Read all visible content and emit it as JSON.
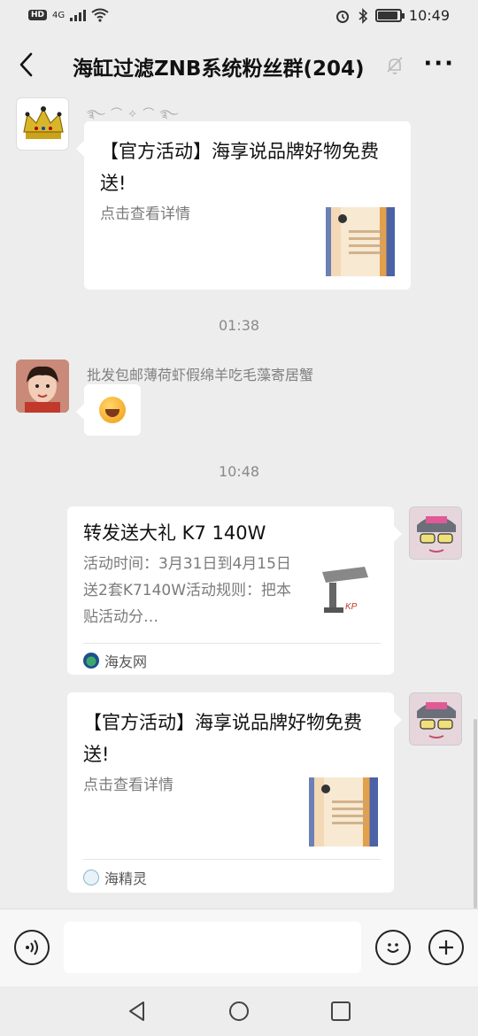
{
  "status_bar": {
    "hd": "HD",
    "network": "4G",
    "time": "10:49",
    "battery_level": 0.9
  },
  "nav": {
    "title": "海缸过滤ZNB系统粉丝群(204)",
    "more": "···"
  },
  "messages": {
    "first_card": {
      "title": "【官方活动】海享说品牌好物免费送!",
      "desc": "点击查看详情"
    },
    "time1": "01:38",
    "sender2": "批发包邮薄荷虾假绵羊吃毛藻寄居蟹",
    "time2": "10:48",
    "card2": {
      "title": "转发送大礼 K7 140W",
      "desc": "活动时间：3月31日到4月15日送2套K7140W活动规则：把本贴活动分…",
      "source": "海友网"
    },
    "card3": {
      "title": "【官方活动】海享说品牌好物免费送!",
      "desc": "点击查看详情",
      "source": "海精灵"
    }
  },
  "icons": {
    "back": "back-icon",
    "mute": "mute-bell-icon",
    "voice": "voice-icon",
    "emoji": "emoji-icon",
    "add": "add-icon"
  }
}
